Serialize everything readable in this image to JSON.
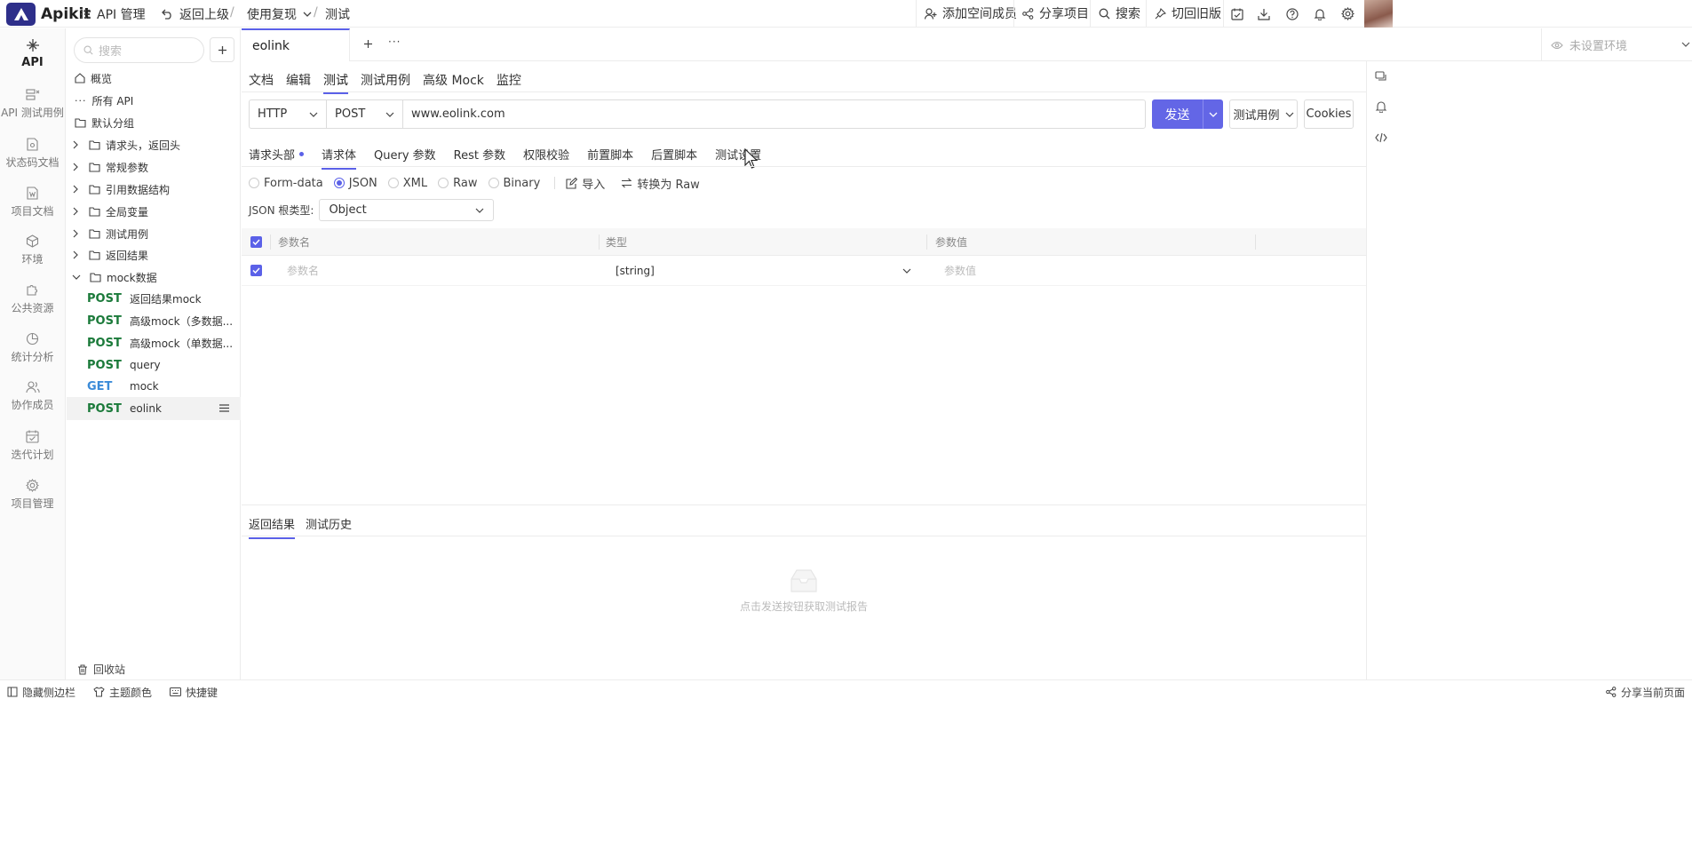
{
  "app": {
    "name": "Apikit",
    "accent": "#5b61e8",
    "method_post_color": "#1b7a3a",
    "method_get_color": "#3b8bd8"
  },
  "topbar": {
    "api_manage": "API 管理",
    "back": "返回上级",
    "project": "使用复现",
    "page": "测试",
    "add_member": "添加空间成员",
    "share_project": "分享项目",
    "search": "搜索",
    "old_version": "切回旧版"
  },
  "rail": {
    "items": [
      {
        "label": "API",
        "icon": "api-icon"
      },
      {
        "label": "API 测试用例",
        "icon": "test-case-icon"
      },
      {
        "label": "状态码文档",
        "icon": "status-code-icon"
      },
      {
        "label": "项目文档",
        "icon": "doc-icon"
      },
      {
        "label": "环境",
        "icon": "environment-icon"
      },
      {
        "label": "公共资源",
        "icon": "puzzle-icon"
      },
      {
        "label": "统计分析",
        "icon": "pie-chart-icon"
      },
      {
        "label": "协作成员",
        "icon": "members-icon"
      },
      {
        "label": "迭代计划",
        "icon": "calendar-icon"
      },
      {
        "label": "项目管理",
        "icon": "gear-icon"
      }
    ]
  },
  "tree": {
    "search_placeholder": "搜索",
    "overview": "概览",
    "all_api": "所有 API",
    "default_group": "默认分组",
    "folders": [
      "请求头，返回头",
      "常规参数",
      "引用数据结构",
      "全局变量",
      "测试用例",
      "返回结果",
      "mock数据"
    ],
    "apis": [
      {
        "method": "POST",
        "name": "返回结果mock"
      },
      {
        "method": "POST",
        "name": "高级mock（多数据..."
      },
      {
        "method": "POST",
        "name": "高级mock（单数据..."
      },
      {
        "method": "POST",
        "name": "query"
      },
      {
        "method": "GET",
        "name": "mock"
      },
      {
        "method": "POST",
        "name": "eolink"
      }
    ],
    "recycle": "回收站"
  },
  "tabs": {
    "active": "eolink",
    "env": "未设置环境"
  },
  "subtabs": [
    "文档",
    "编辑",
    "测试",
    "测试用例",
    "高级 Mock",
    "监控"
  ],
  "request": {
    "protocol": "HTTP",
    "method": "POST",
    "url": "www.eolink.com",
    "send": "发送",
    "test_case": "测试用例",
    "cookies": "Cookies"
  },
  "reqtabs": [
    "请求头部",
    "请求体",
    "Query 参数",
    "Rest 参数",
    "权限校验",
    "前置脚本",
    "后置脚本",
    "测试设置"
  ],
  "body_types": [
    "Form-data",
    "JSON",
    "XML",
    "Raw",
    "Binary"
  ],
  "tools": {
    "import": "导入",
    "to_raw": "转换为 Raw"
  },
  "json_root": {
    "label": "JSON 根类型:",
    "value": "Object"
  },
  "params": {
    "headers": [
      "参数名",
      "类型",
      "参数值"
    ],
    "row": {
      "name_placeholder": "参数名",
      "type": "[string]",
      "value_placeholder": "参数值"
    }
  },
  "result": {
    "tabs": [
      "返回结果",
      "测试历史"
    ],
    "empty": "点击发送按钮获取测试报告"
  },
  "statusbar": {
    "hide_sidebar": "隐藏侧边栏",
    "theme": "主题颜色",
    "shortcuts": "快捷键",
    "share_page": "分享当前页面"
  }
}
